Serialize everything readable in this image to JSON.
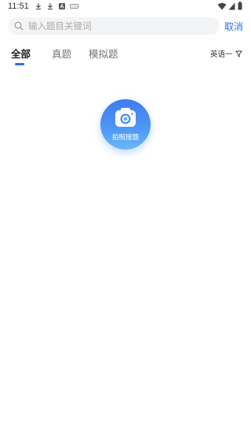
{
  "status_bar": {
    "time": "11:51",
    "left_icons": [
      "download-icon",
      "download-icon",
      "app-notification-icon",
      "keyboard-icon"
    ],
    "right_icons": [
      "wifi-icon",
      "signal-icon",
      "battery-icon"
    ]
  },
  "search": {
    "placeholder": "输入题目关键词",
    "value": "",
    "icon": "search-icon",
    "cancel_label": "取消"
  },
  "tabs": [
    {
      "label": "全部",
      "active": true
    },
    {
      "label": "真题",
      "active": false
    },
    {
      "label": "模拟题",
      "active": false
    }
  ],
  "filter": {
    "label": "英语一",
    "icon": "filter-icon"
  },
  "camera_search": {
    "label": "拍照搜题",
    "icon": "camera-icon"
  },
  "colors": {
    "accent": "#2f6fe4",
    "gradient_top": "#3f7cf0",
    "gradient_bottom": "#69b9fb",
    "search_bg": "#f3f4f6"
  }
}
